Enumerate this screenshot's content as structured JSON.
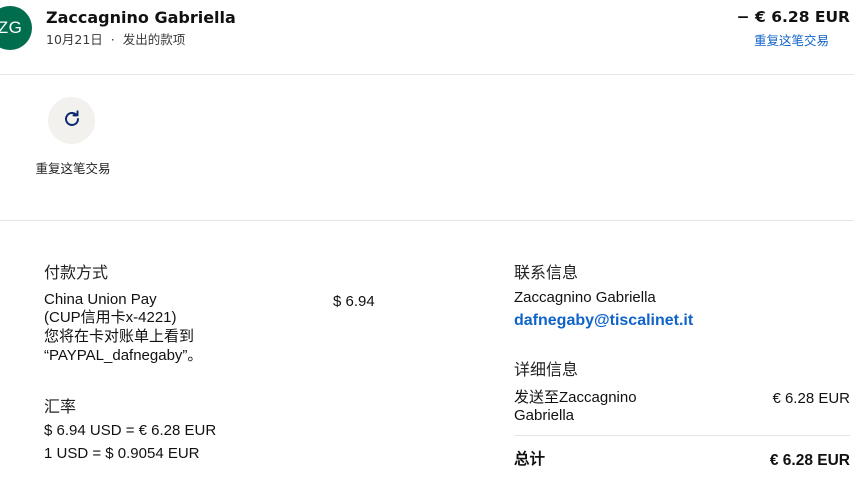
{
  "header": {
    "avatar_initials": "ZG",
    "avatar_color": "#006d4f",
    "name": "Zaccagnino Gabriella",
    "date": "10月21日",
    "separator": "·",
    "type": "发出的款项",
    "amount": "− € 6.28 EUR",
    "repeat_link": "重复这笔交易"
  },
  "action": {
    "icon": "refresh-icon",
    "label": "重复这笔交易"
  },
  "payment": {
    "heading": "付款方式",
    "method_line1": "China Union Pay",
    "method_line2": "(CUP信用卡x-4221)",
    "note_line1": "您将在卡对账单上看到",
    "note_line2": "“PAYPAL_dafnegaby”。",
    "amount": "$ 6.94"
  },
  "exchange": {
    "heading": "汇率",
    "line1": "$ 6.94 USD = € 6.28 EUR",
    "line2": "1 USD = $ 0.9054 EUR"
  },
  "contact": {
    "heading": "联系信息",
    "name": "Zaccagnino Gabriella",
    "email": "dafnegaby@tiscalinet.it"
  },
  "details": {
    "heading": "详细信息",
    "sent_line1": "发送至Zaccagnino",
    "sent_line2": "Gabriella",
    "sent_amount": "€ 6.28 EUR",
    "total_label": "总计",
    "total_amount": "€ 6.28 EUR"
  },
  "colors": {
    "link": "#0f63c9",
    "divider": "#e6e6e6",
    "action_bg": "#f3f1ed"
  }
}
